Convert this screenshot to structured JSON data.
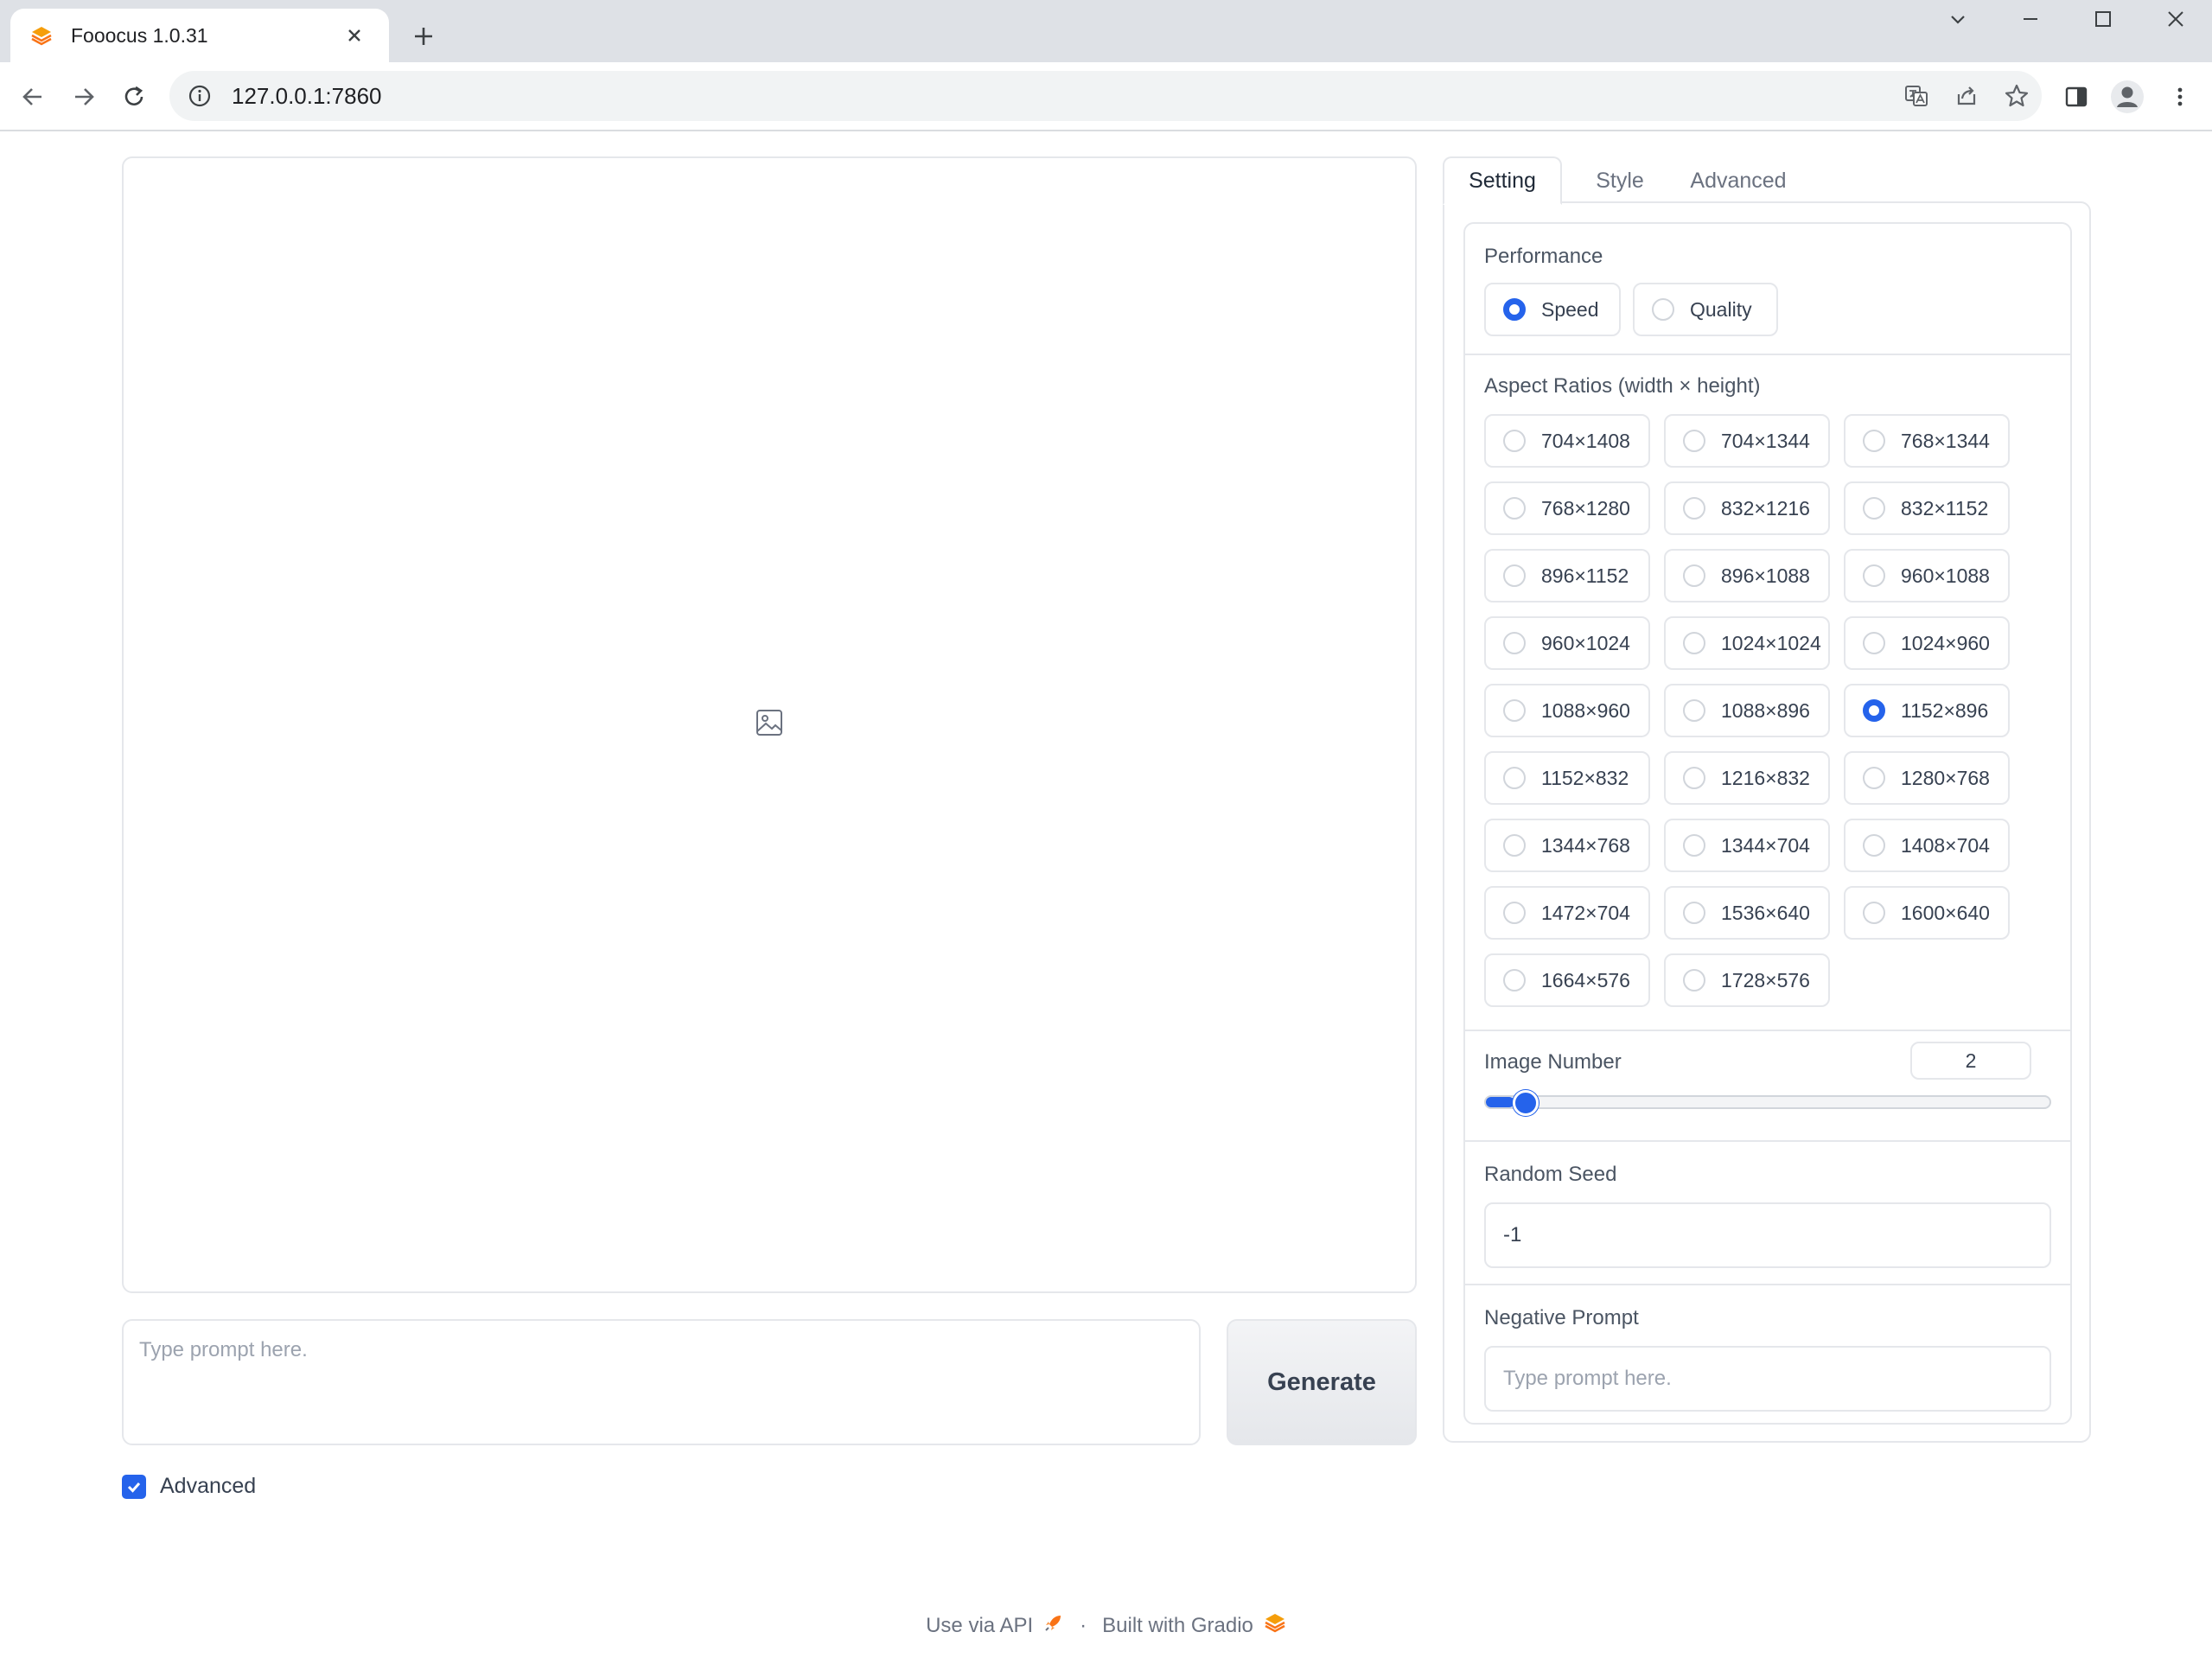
{
  "browser": {
    "tab_title": "Fooocus 1.0.31",
    "url": "127.0.0.1:7860"
  },
  "app": {
    "prompt_placeholder": "Type prompt here.",
    "generate_label": "Generate",
    "advanced_label": "Advanced",
    "advanced_checked": true
  },
  "panel": {
    "tabs": [
      {
        "label": "Setting",
        "active": true
      },
      {
        "label": "Style",
        "active": false
      },
      {
        "label": "Advanced",
        "active": false
      }
    ],
    "performance": {
      "label": "Performance",
      "options": [
        "Speed",
        "Quality"
      ],
      "selected": "Speed"
    },
    "aspect_ratios": {
      "label": "Aspect Ratios (width × height)",
      "options": [
        "704×1408",
        "704×1344",
        "768×1344",
        "768×1280",
        "832×1216",
        "832×1152",
        "896×1152",
        "896×1088",
        "960×1088",
        "960×1024",
        "1024×1024",
        "1024×960",
        "1088×960",
        "1088×896",
        "1152×896",
        "1152×832",
        "1216×832",
        "1280×768",
        "1344×768",
        "1344×704",
        "1408×704",
        "1472×704",
        "1536×640",
        "1600×640",
        "1664×576",
        "1728×576"
      ],
      "selected": "1152×896"
    },
    "image_number": {
      "label": "Image Number",
      "value": "2",
      "fraction": 0.05
    },
    "random_seed": {
      "label": "Random Seed",
      "value": "-1"
    },
    "negative_prompt": {
      "label": "Negative Prompt",
      "placeholder": "Type prompt here."
    }
  },
  "footer": {
    "api_label": "Use via API",
    "separator": "·",
    "built_label": "Built with Gradio"
  },
  "colors": {
    "accent": "#2563eb",
    "gradio_orange": "#f97316"
  }
}
